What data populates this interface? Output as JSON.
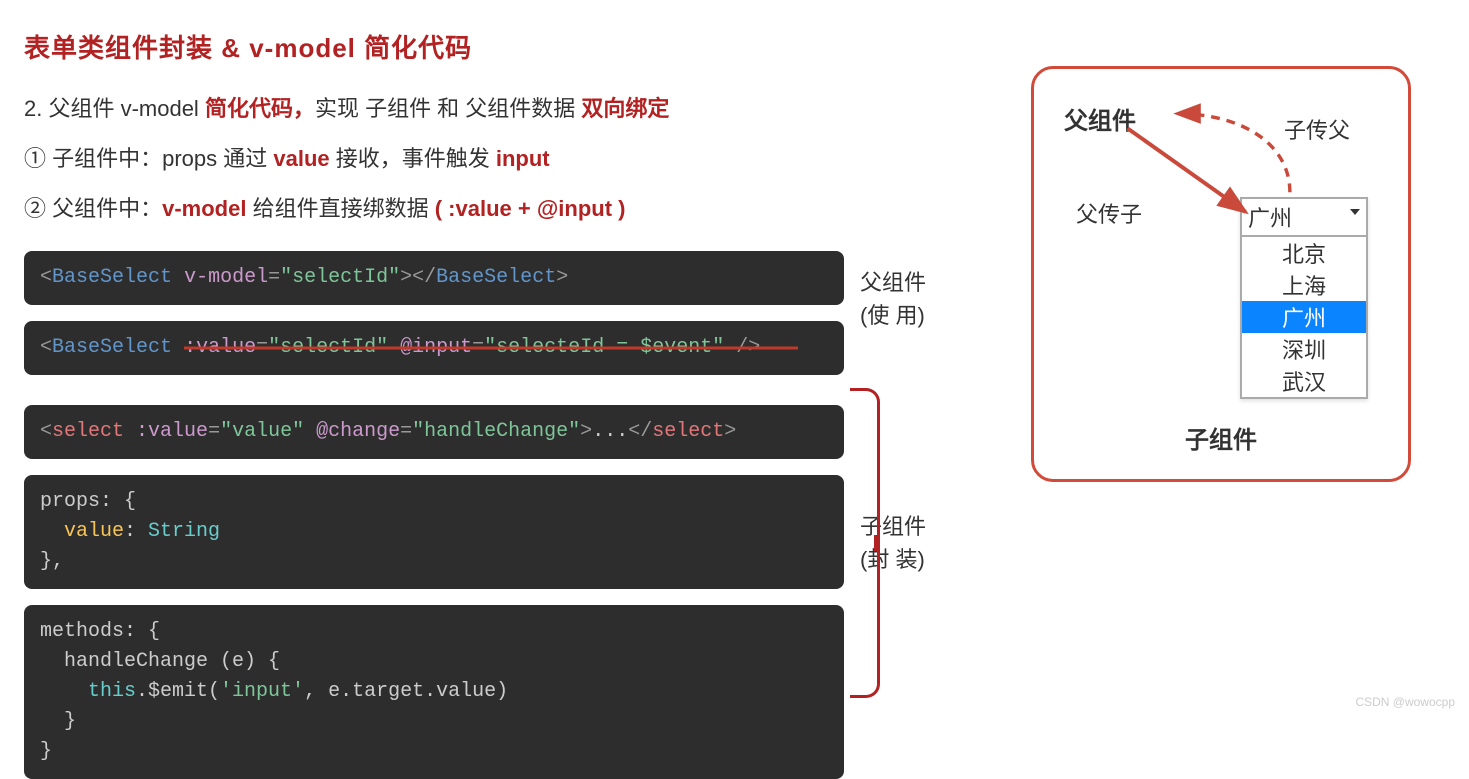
{
  "title": "表单类组件封装 & v-model 简化代码",
  "bullet2": {
    "prefix": "2. 父组件 v-model ",
    "red1": "简化代码，",
    "mid": "实现 子组件 和 父组件数据 ",
    "red2": "双向绑定"
  },
  "step1": {
    "num": "① 子组件中：props 通过 ",
    "r1": "value",
    "mid": " 接收，事件触发 ",
    "r2": "input"
  },
  "step2": {
    "num": "② 父组件中：",
    "r1": "v-model",
    "mid": " 给组件直接绑数据   ",
    "r2": "( :value + @input )"
  },
  "code1": {
    "lt1": "<",
    "tag1": "BaseSelect",
    "sp": " ",
    "attr": "v-model",
    "eq": "=",
    "q1": "\"",
    "val": "selectId",
    "q2": "\"",
    "gt1": ">",
    "lt2": "</",
    "tag2": "BaseSelect",
    "gt2": ">"
  },
  "code2": {
    "lt": "<",
    "tag": "BaseSelect",
    "sp": " ",
    "a1": ":value",
    "eq": "=",
    "v1": "\"selectId\"",
    "sp2": " ",
    "a2": "@input",
    "v2": "\"selecteId = $event\"",
    "end": " />"
  },
  "code3": {
    "lt": "<",
    "tag": "select",
    "sp": " ",
    "a1": ":value",
    "eq": "=",
    "v1": "\"value\"",
    "sp2": " ",
    "a2": "@change",
    "v2": "\"handleChange\"",
    "gt": ">",
    "dots": "...",
    "lt2": "</",
    "tag2": "select",
    "gt2": ">"
  },
  "code4": {
    "l1a": "props: {",
    "l2a": "  ",
    "l2b": "value",
    "l2c": ": ",
    "l2d": "String",
    "l3a": "},"
  },
  "code5": {
    "l1": "methods: {",
    "l2": "  handleChange (e) {",
    "l3a": "    ",
    "l3b": "this",
    "l3c": ".$emit(",
    "l3d": "'input'",
    "l3e": ", e.target.value)",
    "l4": "  }",
    "l5": "}"
  },
  "side": {
    "parent": "父组件",
    "parent_use": "(使  用)",
    "child": "子组件",
    "child_wrap": "(封  装)"
  },
  "diagram": {
    "parent": "父组件",
    "child_to_parent": "子传父",
    "parent_to_child": "父传子",
    "child": "子组件",
    "select_head": "广州",
    "options": [
      "北京",
      "上海",
      "广州",
      "深圳",
      "武汉"
    ],
    "selected_index": 2
  },
  "watermark": "CSDN @wowocpp"
}
